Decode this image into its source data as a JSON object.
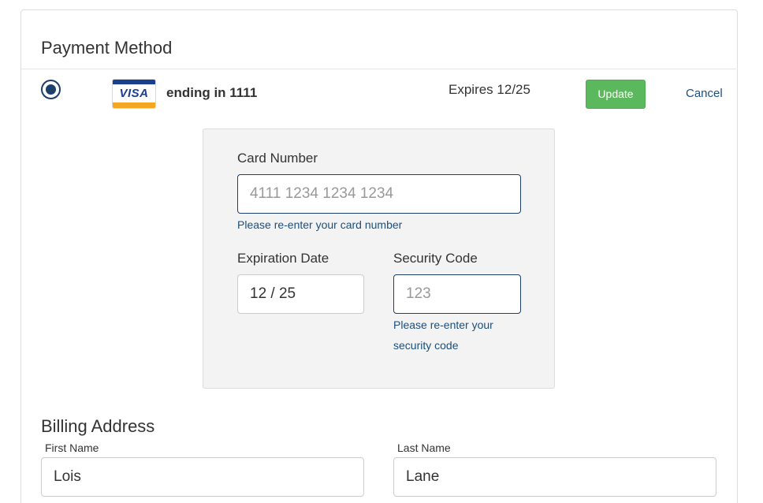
{
  "payment": {
    "title": "Payment Method",
    "card": {
      "brand_logo_text": "VISA",
      "ending_text": "ending in 1111",
      "expires_text": "Expires 12/25",
      "selected": true
    },
    "update_label": "Update",
    "cancel_label": "Cancel"
  },
  "card_form": {
    "card_number": {
      "label": "Card Number",
      "value": "",
      "placeholder": "4111 1234 1234 1234",
      "help": "Please re-enter your card number"
    },
    "expiration": {
      "label": "Expiration Date",
      "value": "12 / 25",
      "placeholder": ""
    },
    "security_code": {
      "label": "Security Code",
      "value": "",
      "placeholder": "123",
      "help": "Please re-enter your security code"
    }
  },
  "billing": {
    "title": "Billing Address",
    "first_name": {
      "label": "First Name",
      "value": "Lois"
    },
    "last_name": {
      "label": "Last Name",
      "value": "Lane"
    }
  },
  "colors": {
    "accent": "#1c3f6b",
    "update_button": "#5cb85c",
    "link": "#1c4f7c",
    "form_background": "#f3f3f3"
  }
}
